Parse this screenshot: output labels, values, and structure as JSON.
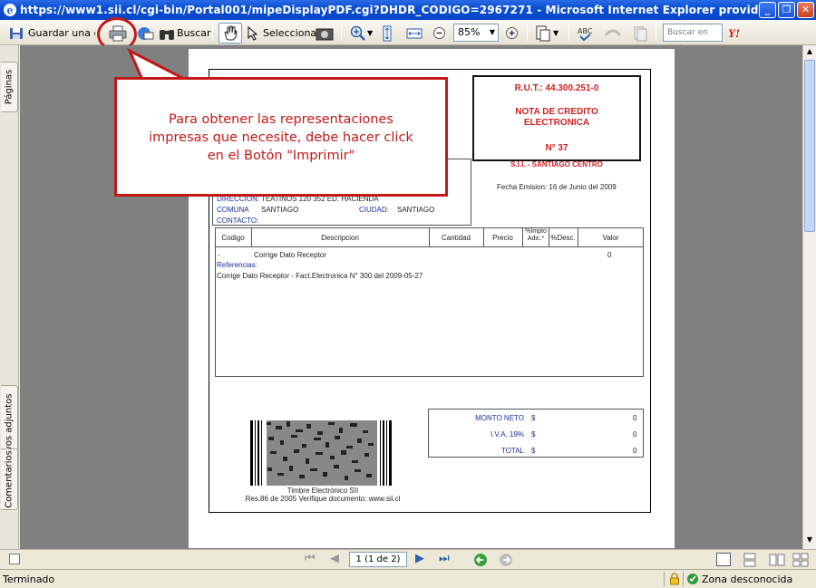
{
  "window": {
    "title": "https://www1.sii.cl/cgi-bin/Portal001/mipeDisplayPDF.cgi?DHDR_CODIGO=2967271 - Microsoft Internet Explorer provided by SII"
  },
  "toolbar": {
    "save_copy_label": "Guardar una copia",
    "search_label": "Buscar",
    "select_label": "Seleccionar",
    "zoom_value": "85%",
    "web_search_placeholder": "Buscar en Web"
  },
  "left_nav": {
    "tab_pages": "Páginas",
    "tab_attachments": "Archivos adjuntos",
    "tab_comments": "Comentarios"
  },
  "callout": {
    "text_line1": "Para obtener las representaciones",
    "text_line2": "impresas que necesite, debe hacer click",
    "text_line3": "en el Botón \"Imprimir\""
  },
  "document": {
    "rut": "R.U.T.: 44.300.251-0",
    "doc_type_line1": "NOTA DE CREDITO",
    "doc_type_line2": "ELECTRONICA",
    "doc_number": "N° 37",
    "sii_office": "S.I.I. - SANTIAGO CENTRO",
    "fecha_label": "Fecha Emision:",
    "fecha_value": "16 de Junio del 2009",
    "direccion_label": "DIRECCION:",
    "direccion_value": "TEATINOS 120 352 ED. HACIENDA",
    "comuna_label": "COMUNA",
    "comuna_value": "SANTIAGO",
    "ciudad_label": "CIUDAD:",
    "ciudad_value": "SANTIAGO",
    "contacto_label": "CONTACTO:",
    "columns": [
      "Codigo",
      "Descripcion",
      "Cantidad",
      "Precio",
      "%Impto Adic.*",
      "%Desc.",
      "Valor"
    ],
    "item_code": "-",
    "item_desc": "Corrige Dato Receptor",
    "item_value": "0",
    "referencias_label": "Referencias:",
    "referencia_text": "Corrige Dato Receptor - Fact.Electronica N° 300 del 2009-05-27",
    "totals": [
      {
        "label": "MONTO NETO",
        "currency": "$",
        "value": "0"
      },
      {
        "label": "I.V.A. 19%",
        "currency": "$",
        "value": "0"
      },
      {
        "label": "TOTAL",
        "currency": "$",
        "value": "0"
      }
    ],
    "timbre_line1": "Timbre Electrónico SII",
    "timbre_line2": "Res.86 de 2005 Verifique documento: www.sii.cl"
  },
  "navigation": {
    "page_indicator": "1 (1 de 2)"
  },
  "status": {
    "left_text": "Terminado",
    "zone_text": "Zona desconocida"
  },
  "colors": {
    "title_bar": "#0a4ed3",
    "callout_red": "#c41818",
    "doc_red": "#d01f1f",
    "doc_background": "#808080"
  }
}
